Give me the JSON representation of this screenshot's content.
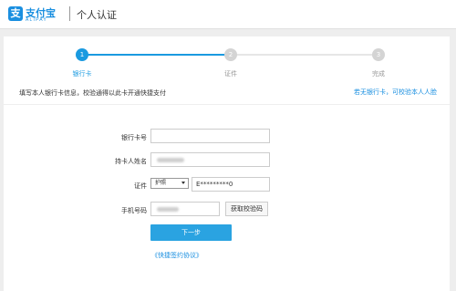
{
  "header": {
    "logo_glyph": "支",
    "logo_cn": "支付宝",
    "logo_en": "ALIPAY",
    "title": "个人认证"
  },
  "steps": [
    {
      "number": "1",
      "label": "银行卡",
      "active": true
    },
    {
      "number": "2",
      "label": "证件",
      "active": false
    },
    {
      "number": "3",
      "label": "完成",
      "active": false
    }
  ],
  "instruction": "填写本人银行卡信息，校验通得以此卡开通快捷支付",
  "alt_link": "若无银行卡，可校验本人人脸",
  "form": {
    "card_number_label": "银行卡号",
    "card_number_value": "",
    "holder_name_label": "持卡人姓名",
    "id_label": "证件",
    "id_type_value": "护照",
    "id_number_value": "E*********0",
    "phone_label": "手机号码",
    "get_code_label": "获取校验码",
    "next_label": "下一步",
    "agreement_link": "《快捷签约协议》"
  },
  "colors": {
    "accent": "#1a8fe0",
    "button": "#2aa3e1",
    "inactive_step": "#d4d4d4"
  }
}
